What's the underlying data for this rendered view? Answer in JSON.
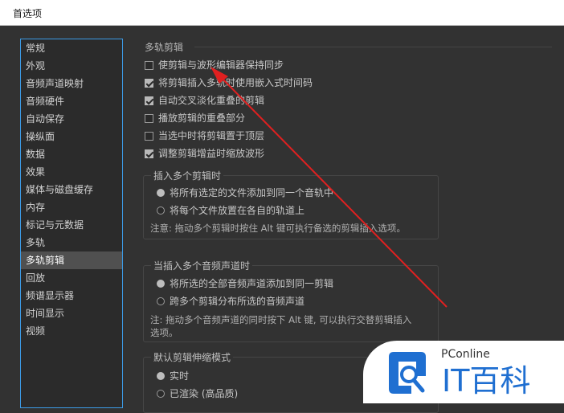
{
  "window": {
    "title": "首选项"
  },
  "sidebar": {
    "items": [
      {
        "label": "常规",
        "selected": false
      },
      {
        "label": "外观",
        "selected": false
      },
      {
        "label": "音频声道映射",
        "selected": false
      },
      {
        "label": "音频硬件",
        "selected": false
      },
      {
        "label": "自动保存",
        "selected": false
      },
      {
        "label": "操纵面",
        "selected": false
      },
      {
        "label": "数据",
        "selected": false
      },
      {
        "label": "效果",
        "selected": false
      },
      {
        "label": "媒体与磁盘缓存",
        "selected": false
      },
      {
        "label": "内存",
        "selected": false
      },
      {
        "label": "标记与元数据",
        "selected": false
      },
      {
        "label": "多轨",
        "selected": false
      },
      {
        "label": "多轨剪辑",
        "selected": true
      },
      {
        "label": "回放",
        "selected": false
      },
      {
        "label": "频谱显示器",
        "selected": false
      },
      {
        "label": "时间显示",
        "selected": false
      },
      {
        "label": "视频",
        "selected": false
      }
    ]
  },
  "main": {
    "section_title": "多轨剪辑",
    "checkboxes": [
      {
        "label": "使剪辑与波形编辑器保持同步",
        "checked": false
      },
      {
        "label": "将剪辑插入多轨时使用嵌入式时间码",
        "checked": true
      },
      {
        "label": "自动交叉淡化重叠的剪辑",
        "checked": true
      },
      {
        "label": "播放剪辑的重叠部分",
        "checked": false
      },
      {
        "label": "当选中时将剪辑置于顶层",
        "checked": false
      },
      {
        "label": "调整剪辑增益时缩放波形",
        "checked": true
      }
    ],
    "group_insert": {
      "title": "插入多个剪辑时",
      "options": [
        {
          "label": "将所有选定的文件添加到同一个音轨中",
          "selected": true
        },
        {
          "label": "将每个文件放置在各自的轨道上",
          "selected": false
        }
      ],
      "note": "注意: 拖动多个剪辑时按住 Alt 键可执行备选的剪辑插入选项。"
    },
    "group_channels": {
      "title": "当插入多个音频声道时",
      "options": [
        {
          "label": "将所选的全部音频声道添加到同一剪辑",
          "selected": true
        },
        {
          "label": "跨多个剪辑分布所选的音频声道",
          "selected": false
        }
      ],
      "note_line1": "注: 拖动多个音频声道的同时按下 Alt 键, 可以执行交替剪辑插入",
      "note_line2": "选项。"
    },
    "group_stretch": {
      "title": "默认剪辑伸缩模式",
      "options": [
        {
          "label": "实时",
          "selected": true
        },
        {
          "label": "已渲染 (高品质)",
          "selected": false
        }
      ]
    }
  },
  "watermark": {
    "brand_small": "PConline",
    "brand_large": "IT百科"
  },
  "colors": {
    "accent_border": "#3c9be6",
    "annotation_arrow": "#e02020",
    "watermark_blue": "#1f6fd1"
  }
}
